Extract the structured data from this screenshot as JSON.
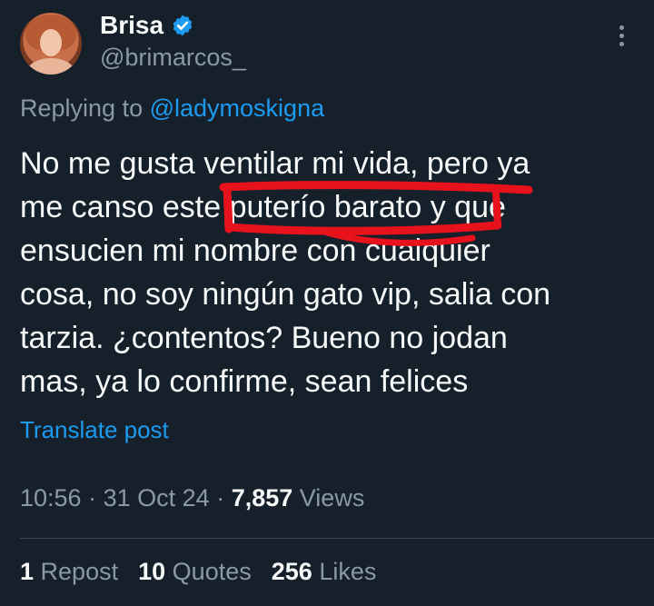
{
  "author": {
    "name": "Brisa",
    "handle": "@brimarcos_"
  },
  "reply": {
    "prefix": "Replying to",
    "mention": "@ladymoskigna"
  },
  "tweet": {
    "lines": [
      "No me gusta ventilar mi vida, pero ya",
      "me canso este puterío barato y que",
      "ensucien mi nombre con cualquier",
      "cosa, no soy ningún gato vip, salia con",
      "tarzia. ¿contentos? Bueno no jodan",
      "mas, ya lo confirme, sean felices"
    ]
  },
  "translate_label": "Translate post",
  "meta": {
    "time": "10:56",
    "date": "31 Oct 24",
    "views_count": "7,857",
    "views_label": "Views"
  },
  "stats": {
    "reposts_count": "1",
    "reposts_label": "Repost",
    "quotes_count": "10",
    "quotes_label": "Quotes",
    "likes_count": "256",
    "likes_label": "Likes"
  },
  "colors": {
    "background": "#15202b",
    "link": "#1d9bf0",
    "muted": "#8b98a5",
    "annotation": "#e8121c"
  }
}
